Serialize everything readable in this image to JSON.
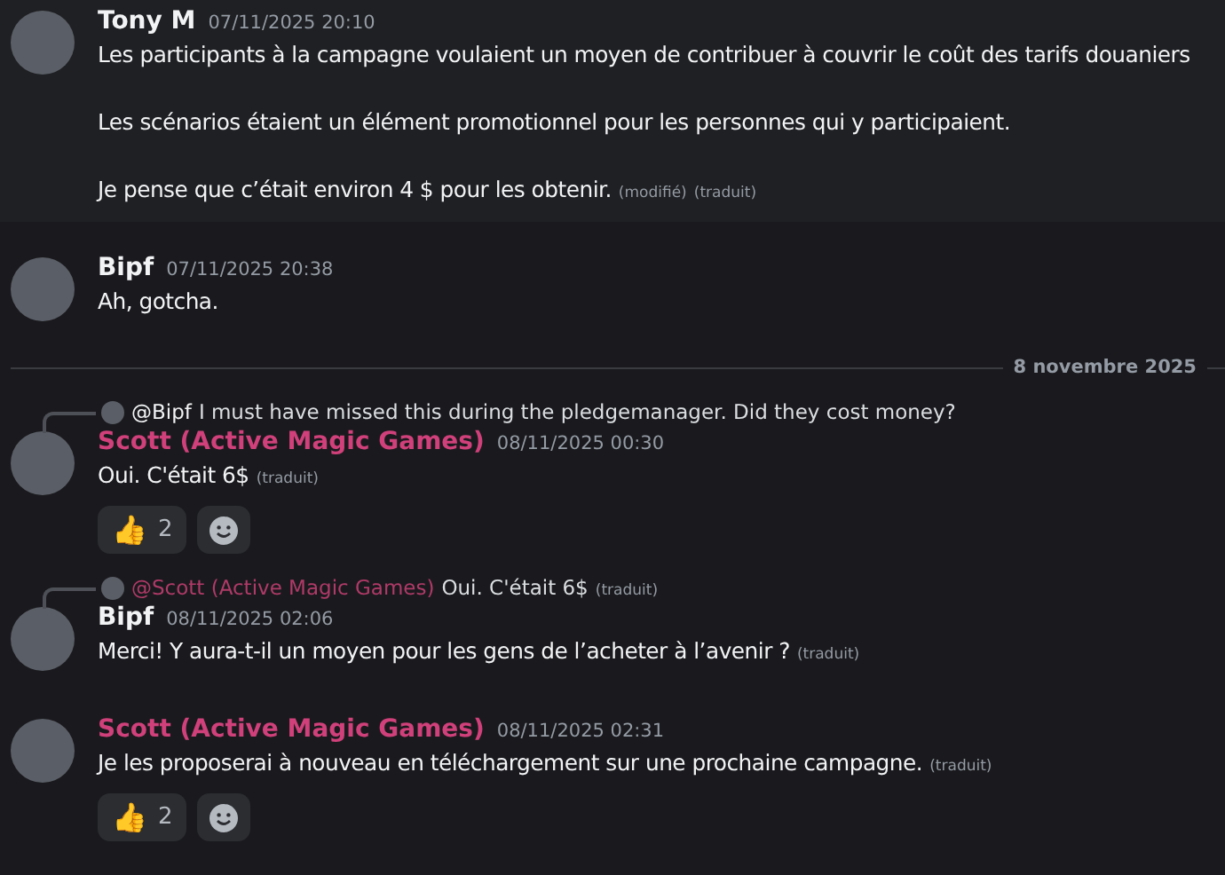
{
  "messages": [
    {
      "author": "Tony M",
      "color": "#f2f3f5",
      "timestamp": "07/11/2025 20:10",
      "paragraphs": [
        "Les participants à la campagne voulaient un moyen de contribuer à couvrir le coût des tarifs douaniers",
        "Les scénarios étaient un élément promotionnel pour les personnes qui y participaient.",
        "Je pense que c’était environ 4 $ pour les obtenir."
      ],
      "tags": [
        "(modifié)",
        "(traduit)"
      ]
    },
    {
      "author": "Bipf",
      "color": "#f2f3f5",
      "timestamp": "07/11/2025 20:38",
      "paragraphs": [
        "Ah, gotcha."
      ]
    },
    {
      "kind": "divider",
      "label": "8 novembre 2025"
    },
    {
      "reply": {
        "mention": "@Bipf",
        "color": "#f2f3f5",
        "text": "I must have missed this during the pledgemanager. Did they cost money?"
      },
      "author": "Scott (Active Magic Games)",
      "color": "#d0407a",
      "timestamp": "08/11/2025 00:30",
      "paragraphs": [
        "Oui. C'était 6$"
      ],
      "tags": [
        "(traduit)"
      ],
      "reactions": [
        {
          "emoji": "👍",
          "count": "2"
        }
      ]
    },
    {
      "reply": {
        "mention": "@Scott (Active Magic Games)",
        "color": "#b03a68",
        "text": "Oui. C'était 6$",
        "tags": [
          "(traduit)"
        ]
      },
      "author": "Bipf",
      "color": "#f2f3f5",
      "timestamp": "08/11/2025 02:06",
      "paragraphs": [
        "Merci! Y aura-t-il un moyen pour les gens de l’acheter à l’avenir ?"
      ],
      "tags": [
        "(traduit)"
      ]
    },
    {
      "author": "Scott (Active Magic Games)",
      "color": "#d0407a",
      "timestamp": "08/11/2025 02:31",
      "paragraphs": [
        "Je les proposerai à nouveau en téléchargement sur une prochaine campagne."
      ],
      "tags": [
        "(traduit)"
      ],
      "reactions": [
        {
          "emoji": "👍",
          "count": "2"
        }
      ]
    }
  ]
}
